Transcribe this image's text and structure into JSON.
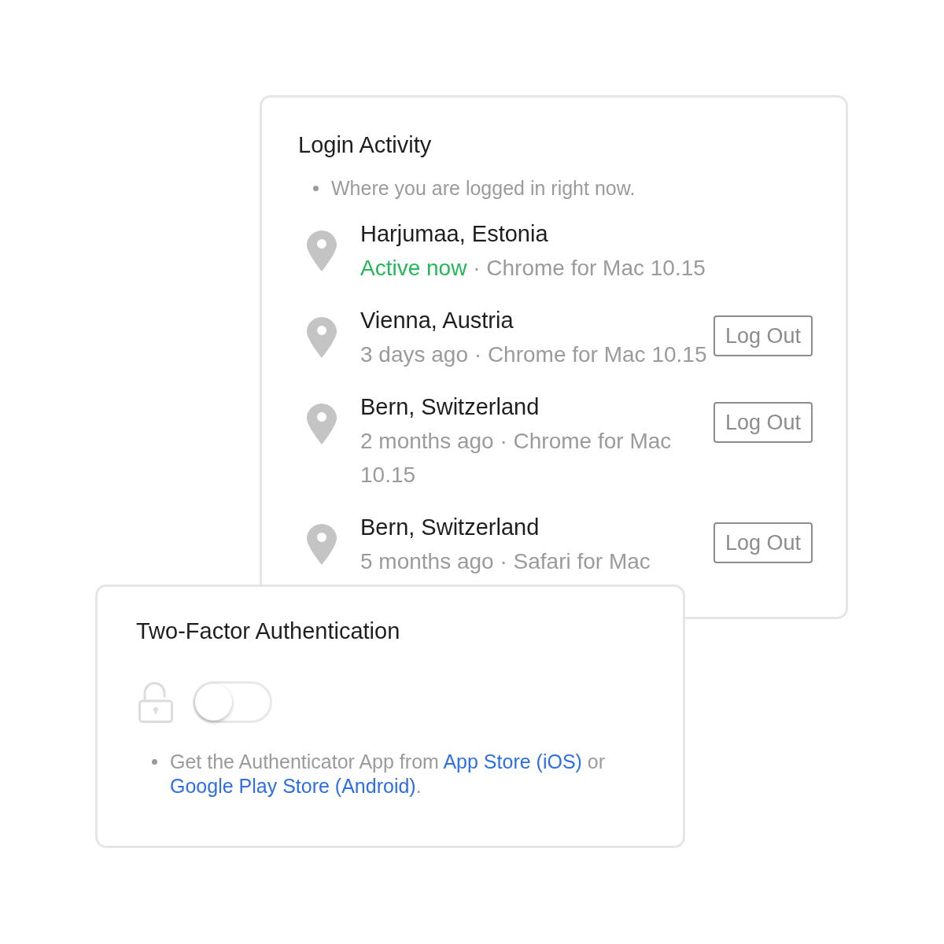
{
  "login_activity": {
    "title": "Login Activity",
    "note": "Where you are logged in right now.",
    "sessions": [
      {
        "location": "Harjumaa, Estonia",
        "time": "Active now",
        "active": true,
        "separator": "·",
        "device": "Chrome for Mac 10.15"
      },
      {
        "location": "Vienna, Austria",
        "time": "3 days ago",
        "active": false,
        "separator": "·",
        "device": "Chrome for Mac 10.15",
        "button": "Log Out"
      },
      {
        "location": "Bern, Switzerland",
        "time": "2 months ago",
        "active": false,
        "separator": "·",
        "device": "Chrome for Mac 10.15",
        "button": "Log Out"
      },
      {
        "location": "Bern, Switzerland",
        "time": "5 months ago",
        "active": false,
        "separator": "·",
        "device": "Safari for Mac",
        "button": "Log Out"
      }
    ]
  },
  "two_factor": {
    "title": "Two-Factor Authentication",
    "toggle": {
      "on": false
    },
    "note": [
      {
        "kind": "text",
        "text": "Get the Authenticator App from "
      },
      {
        "kind": "link",
        "text": "App Store (iOS)"
      },
      {
        "kind": "text",
        "text": " or "
      },
      {
        "kind": "link",
        "text": "Google Play Store (Android)"
      },
      {
        "kind": "text",
        "text": "."
      }
    ]
  }
}
